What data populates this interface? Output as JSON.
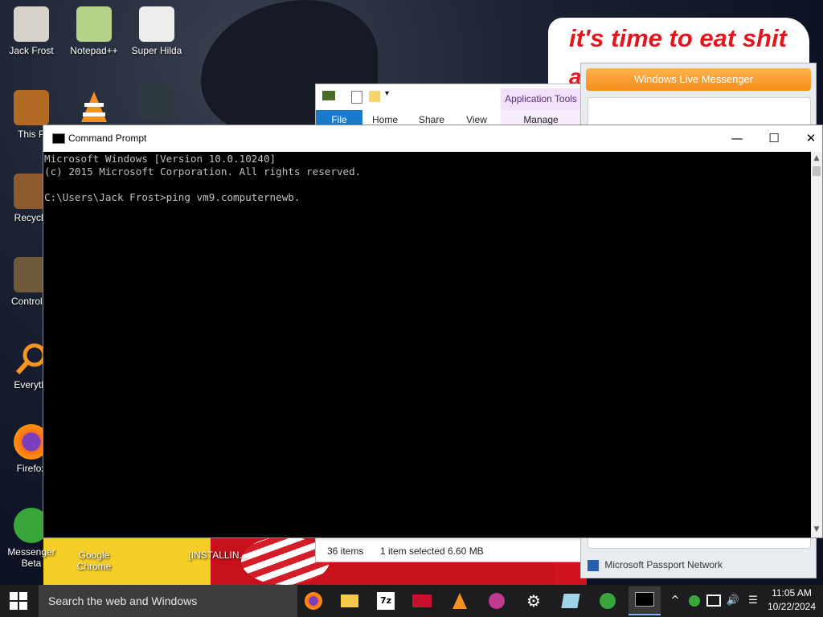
{
  "wallpaper": {
    "caption_text": "it's time to eat shit",
    "caption_fragment": "a"
  },
  "desktop_icons": [
    {
      "label": "Jack Frost",
      "icon": "vampire-avatar-icon"
    },
    {
      "label": "Notepad++",
      "icon": "notepad-plus-plus-icon"
    },
    {
      "label": "Super Hilda",
      "icon": "pixel-art-icon"
    },
    {
      "label": "This P",
      "icon": "this-pc-icon"
    },
    {
      "label": "",
      "icon": "vlc-cone-icon"
    },
    {
      "label": "",
      "icon": "pixel-character-icon"
    },
    {
      "label": "Recycle",
      "icon": "recycle-bin-icon"
    },
    {
      "label": "Control P",
      "icon": "control-panel-icon"
    },
    {
      "label": "Everythi",
      "icon": "everything-search-icon"
    },
    {
      "label": "Firefox",
      "icon": "firefox-icon"
    },
    {
      "label": "Messenger Beta",
      "icon": "messenger-icon"
    },
    {
      "label": "Google Chrome",
      "icon": "chrome-icon"
    },
    {
      "label": "[INSTALLIN...",
      "icon": "installer-icon"
    }
  ],
  "explorer": {
    "tabs": {
      "file": "File",
      "home": "Home",
      "share": "Share",
      "view": "View",
      "manage": "Manage"
    },
    "application_tools": "Application Tools",
    "status": {
      "items": "36 items",
      "selected": "1 item selected",
      "size": "6.60 MB"
    }
  },
  "messenger": {
    "title": "Windows Live Messenger",
    "footer": "Microsoft Passport Network"
  },
  "cmd": {
    "title": "Command Prompt",
    "controls": {
      "minimize": "—",
      "maximize": "☐",
      "close": "✕"
    },
    "lines": [
      "Microsoft Windows [Version 10.0.10240]",
      "(c) 2015 Microsoft Corporation. All rights reserved.",
      "",
      "C:\\Users\\Jack Frost>ping vm9.computernewb."
    ]
  },
  "taskbar": {
    "search_placeholder": "Search the web and Windows",
    "apps": [
      "firefox-icon",
      "file-explorer-icon",
      "7zip-icon",
      "arrow-app-icon",
      "vlc-icon",
      "gear-app-icon",
      "settings-icon",
      "ice-icon",
      "messenger-icon",
      "cmd-icon"
    ],
    "tray": {
      "up": "^",
      "volume": "🔊",
      "notification": "☰"
    },
    "time": "11:05 AM",
    "date": "10/22/2024"
  }
}
